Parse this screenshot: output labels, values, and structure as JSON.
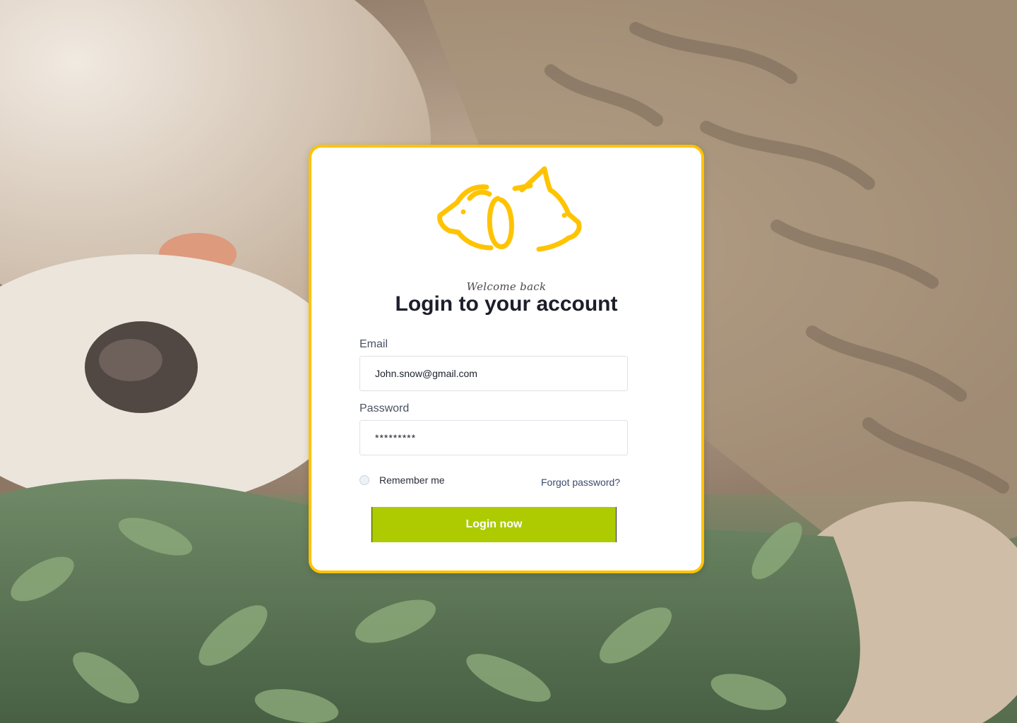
{
  "header": {
    "welcome_text": "Welcome back",
    "title": "Login to your account"
  },
  "form": {
    "email_label": "Email",
    "email_value": "John.snow@gmail.com",
    "password_label": "Password",
    "password_value": "*********",
    "remember_label": "Remember me",
    "remember_checked": false,
    "forgot_link": "Forgot password?",
    "submit_label": "Login now"
  },
  "icons": {
    "logo": "dog-cat-logo-icon"
  },
  "colors": {
    "accent_yellow": "#ffc300",
    "button_green": "#adcb00",
    "title_text": "#1c1f2a",
    "link_text": "#3a4a6e"
  }
}
